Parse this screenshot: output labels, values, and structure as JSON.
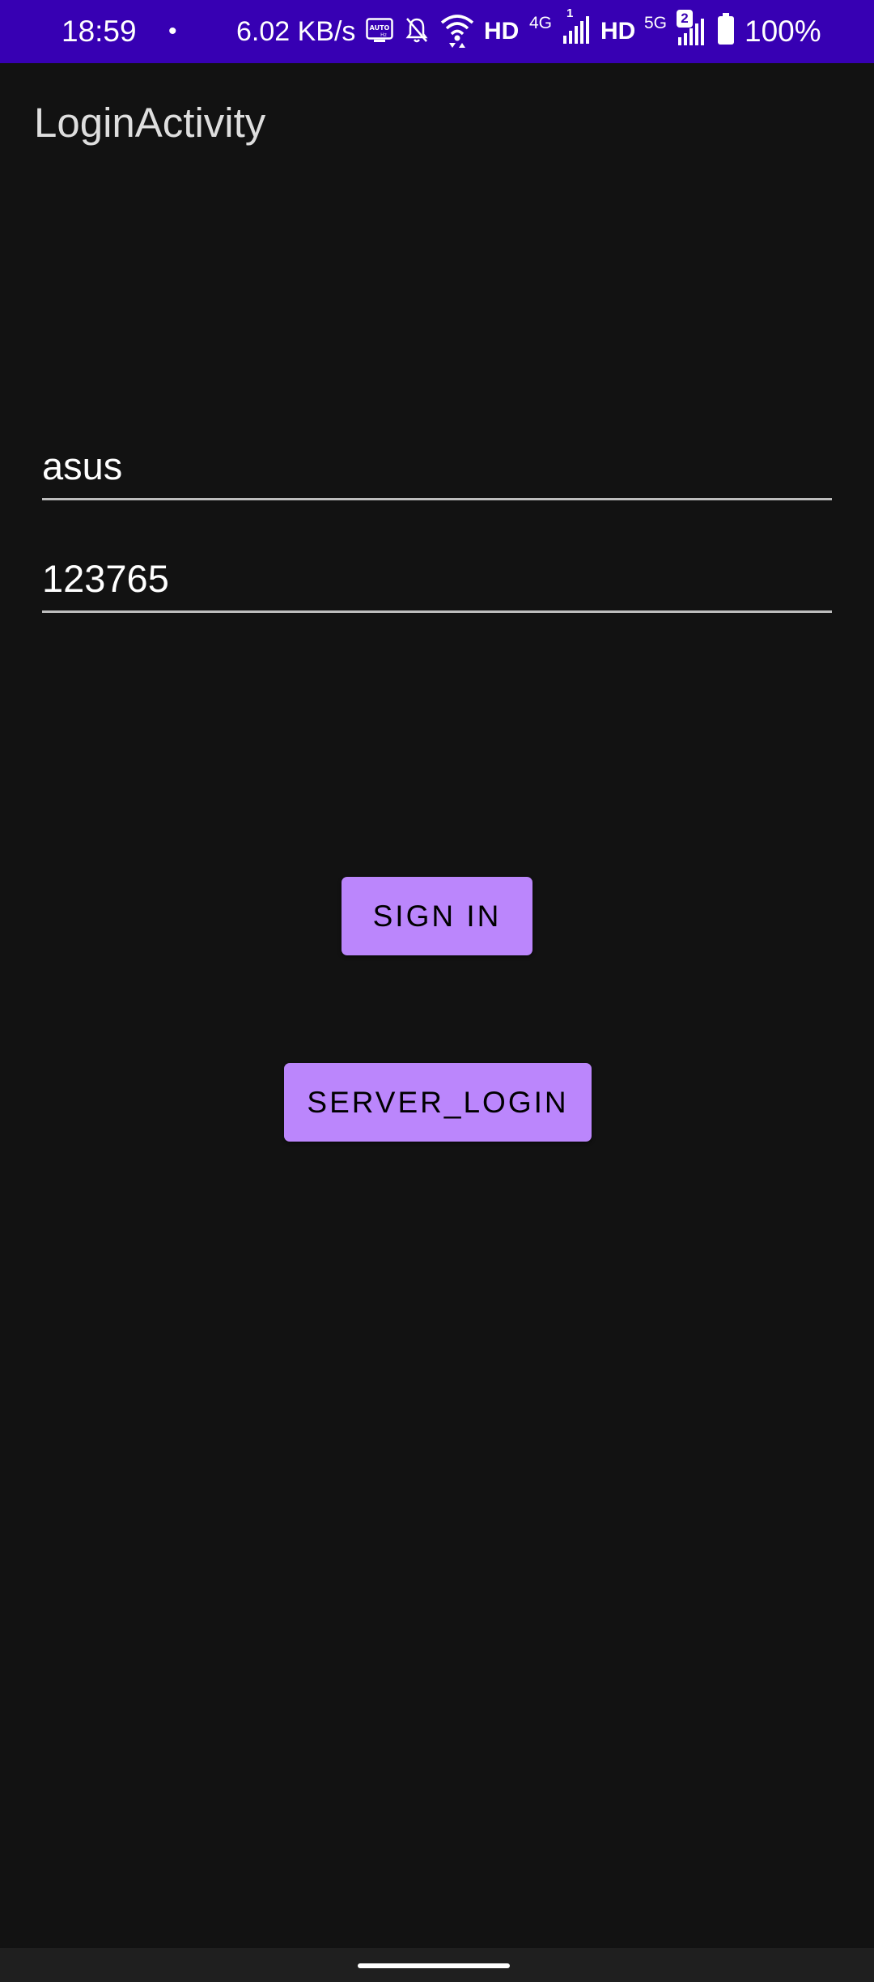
{
  "status_bar": {
    "time": "18:59",
    "dot": "•",
    "net_speed": "6.02 KB/s",
    "hd1": "HD",
    "net_4g": "4G",
    "sim1": "1",
    "hd2": "HD",
    "net_5g": "5G",
    "sim2": "2",
    "battery_pct": "100%",
    "background_color": "#3700b3"
  },
  "app": {
    "title": "LoginActivity"
  },
  "form": {
    "username_value": "asus",
    "password_value": "123765"
  },
  "buttons": {
    "sign_in_label": "SIGN IN",
    "server_login_label": "SERVER_LOGIN",
    "accent_color": "#bb86fc"
  }
}
